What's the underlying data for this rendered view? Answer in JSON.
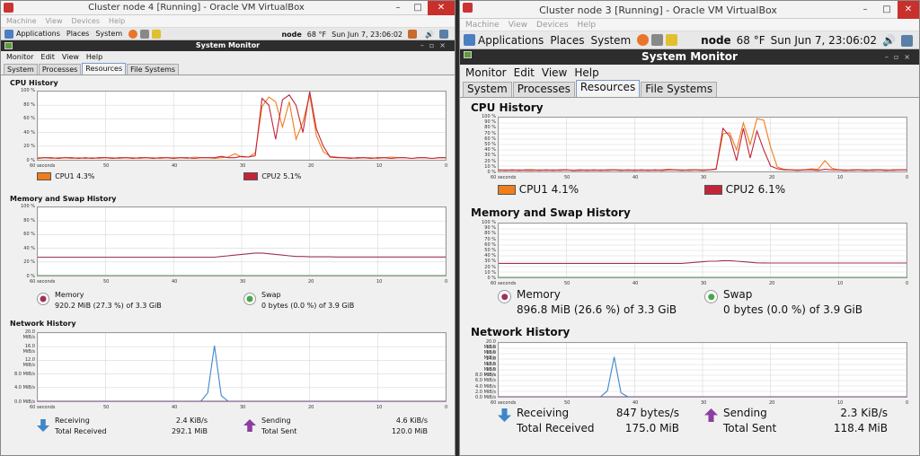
{
  "left": {
    "vb_title": "Cluster node 4 [Running] - Oracle VM VirtualBox",
    "vb_menu": [
      "Machine",
      "View",
      "Devices",
      "Help"
    ],
    "panel": {
      "applications": "Applications",
      "places": "Places",
      "system": "System",
      "host": "node",
      "temp": "68 °F",
      "clock": "Sun Jun  7, 23:06:02"
    },
    "sm_title": "System Monitor",
    "sm_menu": [
      "Monitor",
      "Edit",
      "View",
      "Help"
    ],
    "tabs": [
      "System",
      "Processes",
      "Resources",
      "File Systems"
    ],
    "cpu_title": "CPU History",
    "mem_title": "Memory and Swap History",
    "net_title": "Network History",
    "pct_ticks": [
      "100 %",
      "80 %",
      "60 %",
      "40 %",
      "20 %",
      "0 %"
    ],
    "net_ticks": [
      "20.0 MiB/s",
      "16.0 MiB/s",
      "12.0 MiB/s",
      "8.0 MiB/s",
      "4.0 MiB/s",
      "0.0 MiB/s"
    ],
    "x_ticks": [
      "60 seconds",
      "50",
      "40",
      "30",
      "20",
      "10",
      "0"
    ],
    "cpu1": "CPU1  4.3%",
    "cpu2": "CPU2  5.1%",
    "memory_label": "Memory",
    "memory_value": "920.2 MiB (27.3 %) of 3.3 GiB",
    "swap_label": "Swap",
    "swap_value": "0 bytes (0.0 %) of 3.9 GiB",
    "receiving_label": "Receiving",
    "receiving_value": "2.4 KiB/s",
    "total_received_label": "Total Received",
    "total_received_value": "292.1 MiB",
    "sending_label": "Sending",
    "sending_value": "4.6 KiB/s",
    "total_sent_label": "Total Sent",
    "total_sent_value": "120.0 MiB",
    "cpu1_series": [
      3,
      3,
      2,
      3,
      3,
      2,
      3,
      2,
      3,
      2,
      3,
      3,
      2,
      3,
      3,
      2,
      3,
      3,
      2,
      3,
      3,
      3,
      2,
      4,
      3,
      3,
      2,
      3,
      4,
      9,
      4,
      4,
      10,
      78,
      92,
      85,
      48,
      85,
      30,
      55,
      95,
      35,
      12,
      5,
      4,
      3,
      3,
      2,
      3,
      3,
      2,
      3,
      4,
      3,
      3,
      2,
      3,
      3,
      2,
      3,
      3
    ],
    "cpu2_series": [
      2,
      3,
      3,
      2,
      3,
      3,
      2,
      3,
      2,
      3,
      3,
      2,
      3,
      3,
      2,
      3,
      3,
      2,
      3,
      3,
      2,
      3,
      3,
      2,
      3,
      3,
      3,
      5,
      3,
      3,
      5,
      4,
      6,
      90,
      80,
      30,
      88,
      95,
      80,
      40,
      100,
      45,
      20,
      4,
      3,
      3,
      2,
      3,
      3,
      2,
      3,
      3,
      2,
      3,
      3,
      2,
      3,
      3,
      2,
      3,
      3
    ],
    "mem_series": [
      27,
      27,
      27,
      27,
      27,
      27,
      27,
      27,
      27,
      27,
      27,
      27,
      27,
      27,
      27,
      27,
      27,
      27,
      27,
      27,
      27,
      27,
      27,
      27,
      27,
      27,
      27,
      28,
      29,
      30,
      31,
      32,
      33,
      33,
      32,
      31,
      30,
      29,
      28,
      28,
      27.5,
      27.5,
      27.5,
      27.5,
      27.3,
      27.3,
      27.3,
      27.3,
      27.3,
      27.3,
      27.3,
      27.3,
      27.3,
      27.3,
      27.3,
      27.3,
      27.3,
      27.3,
      27.3,
      27.3,
      27.3
    ],
    "net_series": [
      0,
      0,
      0,
      0,
      0,
      0,
      0,
      0,
      0,
      0,
      0,
      0,
      0,
      0,
      0,
      0,
      0,
      0,
      0,
      0,
      0,
      0,
      0,
      0,
      0,
      0,
      0,
      0,
      0,
      0,
      0,
      0,
      0,
      0,
      0,
      0,
      0,
      0,
      0,
      0,
      0,
      0,
      0,
      0,
      0,
      0,
      0,
      0,
      0,
      0,
      0,
      0,
      0,
      0,
      0,
      0,
      0,
      0,
      0,
      0,
      0
    ],
    "net_peak_pos": 0.43,
    "net_peak_value": 16.3
  },
  "right": {
    "vb_title": "Cluster node 3 [Running] - Oracle VM VirtualBox",
    "vb_menu": [
      "Machine",
      "View",
      "Devices",
      "Help"
    ],
    "panel": {
      "applications": "Applications",
      "places": "Places",
      "system": "System",
      "host": "node",
      "temp": "68 °F",
      "clock": "Sun Jun  7, 23:06:02"
    },
    "sm_title": "System Monitor",
    "sm_menu": [
      "Monitor",
      "Edit",
      "View",
      "Help"
    ],
    "tabs": [
      "System",
      "Processes",
      "Resources",
      "File Systems"
    ],
    "cpu_title": "CPU History",
    "mem_title": "Memory and Swap History",
    "net_title": "Network History",
    "pct_ticks": [
      "100 %",
      "90 %",
      "80 %",
      "70 %",
      "60 %",
      "50 %",
      "40 %",
      "30 %",
      "20 %",
      "10 %",
      "0 %"
    ],
    "net_ticks": [
      "20.0 MiB/s",
      "18.0 MiB/s",
      "16.0 MiB/s",
      "14.0 MiB/s",
      "12.0 MiB/s",
      "10.0 MiB/s",
      "8.0 MiB/s",
      "6.0 MiB/s",
      "4.0 MiB/s",
      "2.0 MiB/s",
      "0.0 MiB/s"
    ],
    "x_ticks": [
      "60 seconds",
      "50",
      "40",
      "30",
      "20",
      "10",
      "0"
    ],
    "cpu1": "CPU1  4.1%",
    "cpu2": "CPU2  6.1%",
    "memory_label": "Memory",
    "memory_value": "896.8 MiB (26.6 %) of 3.3 GiB",
    "swap_label": "Swap",
    "swap_value": "0 bytes (0.0 %) of 3.9 GiB",
    "receiving_label": "Receiving",
    "receiving_value": "847 bytes/s",
    "total_received_label": "Total Received",
    "total_received_value": "175.0 MiB",
    "sending_label": "Sending",
    "sending_value": "2.3 KiB/s",
    "total_sent_label": "Total Sent",
    "total_sent_value": "118.4 MiB",
    "cpu1_series": [
      2,
      3,
      2,
      3,
      2,
      2,
      3,
      2,
      3,
      2,
      3,
      2,
      2,
      3,
      2,
      3,
      2,
      3,
      3,
      2,
      3,
      2,
      3,
      2,
      3,
      4,
      3,
      3,
      2,
      3,
      3,
      3,
      5,
      70,
      72,
      40,
      90,
      50,
      98,
      95,
      45,
      8,
      4,
      3,
      3,
      3,
      5,
      4,
      20,
      6,
      3,
      3,
      2,
      3,
      3,
      2,
      3,
      3,
      2,
      3,
      3
    ],
    "cpu2_series": [
      3,
      2,
      3,
      2,
      3,
      3,
      2,
      3,
      2,
      3,
      3,
      2,
      3,
      2,
      3,
      2,
      3,
      3,
      2,
      3,
      2,
      3,
      2,
      3,
      2,
      3,
      3,
      2,
      3,
      3,
      2,
      3,
      4,
      80,
      65,
      20,
      80,
      25,
      75,
      40,
      10,
      5,
      3,
      3,
      2,
      3,
      3,
      2,
      4,
      3,
      3,
      2,
      3,
      3,
      2,
      3,
      3,
      2,
      3,
      3,
      3
    ],
    "mem_series": [
      26,
      26,
      26,
      26,
      26,
      26,
      26,
      26,
      26,
      26,
      26,
      26,
      26,
      26,
      26,
      26,
      26,
      26,
      26,
      26,
      26,
      26,
      26,
      26,
      26,
      26,
      26,
      26,
      27,
      28,
      29,
      30,
      30,
      31,
      31,
      30,
      29,
      28,
      27,
      26.8,
      26.6,
      26.6,
      26.6,
      26.6,
      26.6,
      26.6,
      26.6,
      26.6,
      26.6,
      26.6,
      26.6,
      26.6,
      26.6,
      26.6,
      26.6,
      26.6,
      26.6,
      26.6,
      26.6,
      26.6,
      26.6
    ],
    "net_series": [
      0,
      0,
      0,
      0,
      0,
      0,
      0,
      0,
      0,
      0,
      0,
      0,
      0,
      0,
      0,
      0,
      0,
      0,
      0,
      0,
      0,
      0,
      0,
      0,
      0,
      0,
      0,
      0,
      0,
      0,
      0,
      0,
      0,
      0,
      0,
      0,
      0,
      0,
      0,
      0,
      0,
      0,
      0,
      0,
      0,
      0,
      0,
      0,
      0,
      0,
      0,
      0,
      0,
      0,
      0,
      0,
      0,
      0,
      0,
      0,
      0
    ],
    "net_peak_pos": 0.29,
    "net_peak_value": 14.8
  },
  "colors": {
    "cpu1": "#f07d1a",
    "cpu2": "#c4243a",
    "memory": "#a0305e",
    "swap": "#4aa54a",
    "net_receive": "#3f87c9",
    "net_send": "#8b3fa0",
    "grid": "#d8d8d8"
  }
}
